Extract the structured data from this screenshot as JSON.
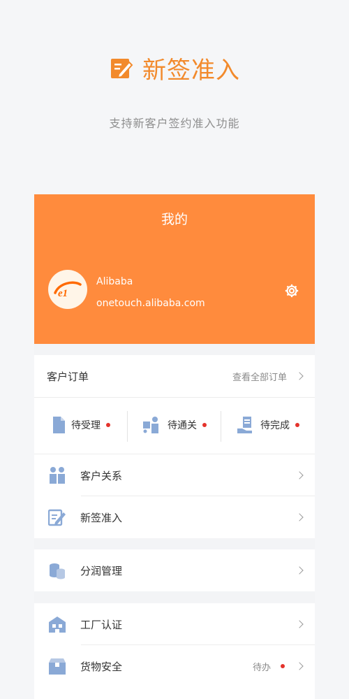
{
  "hero": {
    "title": "新签准入",
    "subtitle": "支持新客户签约准入功能",
    "accent": "#f28a2c"
  },
  "page": {
    "title": "我的",
    "header_color": "#ff8b3d"
  },
  "user": {
    "name": "Alibaba",
    "email": "onetouch.alibaba.com"
  },
  "orders": {
    "title": "客户订单",
    "view_all": "查看全部订单",
    "statuses": [
      {
        "label": "待受理",
        "icon": "document-icon"
      },
      {
        "label": "待通关",
        "icon": "customs-icon"
      },
      {
        "label": "待完成",
        "icon": "hand-receipt-icon"
      }
    ]
  },
  "menu": {
    "customer_relations": "客户关系",
    "new_signing": "新签准入",
    "profit_management": "分润管理",
    "factory_cert": "工厂认证",
    "cargo_safety": "货物安全",
    "cargo_safety_badge": "待办"
  }
}
